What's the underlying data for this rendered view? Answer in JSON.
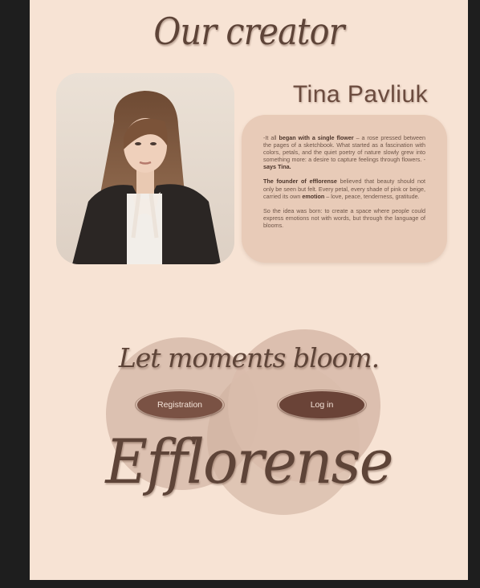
{
  "header": {
    "title": "Our creator"
  },
  "creator": {
    "name": "Tina Pavliuk",
    "bio": {
      "p1": {
        "t1": "It all ",
        "b1": "began with a single flower",
        "t2": " – a rose pressed between the pages of a sketchbook. What started as a fascination with colors, petals, and the quiet poetry of nature slowly grew into something more: a desire to capture feelings through flowers. - ",
        "b2": "says Tina."
      },
      "p2": {
        "b1": "The founder of efflorense",
        "t1": " believed that beauty should not only be seen but felt. Every petal, every shade of pink or beige, carried its own ",
        "b2": "emotion",
        "t2": " – love, peace, tenderness, gratitude."
      },
      "p3": "So the idea was born: to create a space where people could express emotions not with words, but through the language of blooms."
    }
  },
  "cta": {
    "tagline": "Let moments bloom.",
    "registration_label": "Registration",
    "login_label": "Log in"
  },
  "brand": {
    "name": "Efflorense"
  },
  "colors": {
    "background": "#f7e3d4",
    "card": "#e8cbb8",
    "button": "#7a5244",
    "text_dark": "#5e4438"
  }
}
